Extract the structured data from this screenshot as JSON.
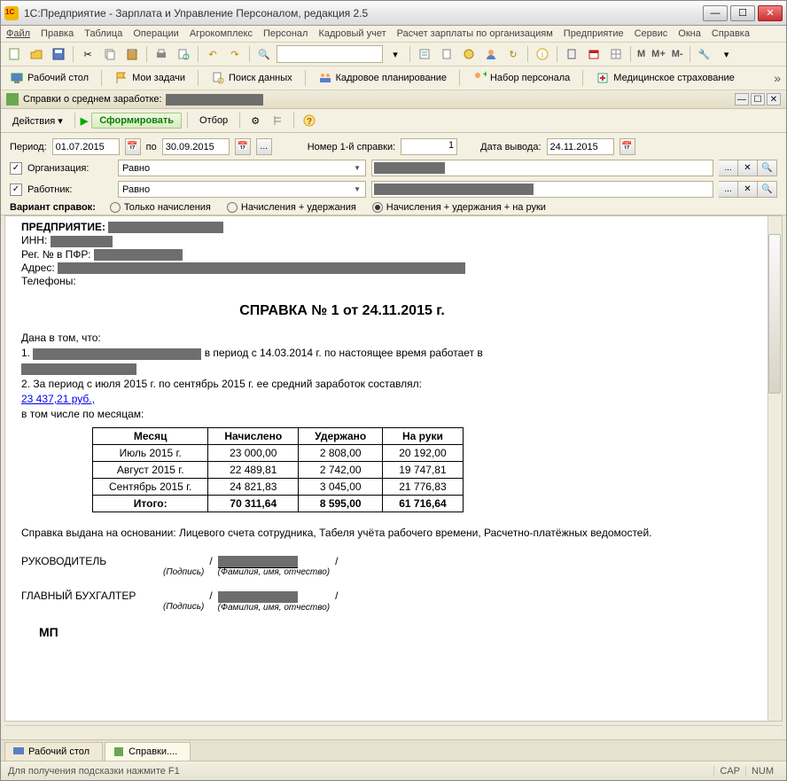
{
  "window": {
    "title": "1С:Предприятие - Зарплата и Управление Персоналом, редакция 2.5"
  },
  "menu": {
    "file": "Файл",
    "edit": "Правка",
    "table": "Таблица",
    "ops": "Операции",
    "agro": "Агрокомплекс",
    "staff": "Персонал",
    "kadr": "Кадровый учет",
    "payroll": "Расчет зарплаты по организациям",
    "enterprise": "Предприятие",
    "service": "Сервис",
    "windows": "Окна",
    "help": "Справка"
  },
  "toolbar_m": {
    "m1": "M",
    "m2": "M+",
    "m3": "M-"
  },
  "navbar": {
    "desktop": "Рабочий стол",
    "tasks": "Мои задачи",
    "search": "Поиск данных",
    "planning": "Кадровое планирование",
    "recruit": "Набор персонала",
    "med": "Медицинское страхование"
  },
  "subwindow": {
    "title": "Справки о среднем заработке:"
  },
  "actionbar": {
    "actions": "Действия",
    "form": "Сформировать",
    "filter": "Отбор"
  },
  "filters": {
    "period_label": "Период:",
    "date_from": "01.07.2015",
    "date_to": "30.09.2015",
    "po": "по",
    "number_label": "Номер 1-й справки:",
    "number_value": "1",
    "outdate_label": "Дата вывода:",
    "outdate_value": "24.11.2015",
    "org_label": "Организация:",
    "org_op": "Равно",
    "worker_label": "Работник:",
    "worker_op": "Равно",
    "variant_label": "Вариант справок:",
    "opt1": "Только начисления",
    "opt2": "Начисления + удержания",
    "opt3": "Начисления + удержания + на руки"
  },
  "doc": {
    "org_label": "ПРЕДПРИЯТИЕ:",
    "inn_label": "ИНН:",
    "pfr_label": "Рег. № в ПФР:",
    "addr_label": "Адрес:",
    "phones_label": "Телефоны:",
    "title": "СПРАВКА № 1 от 24.11.2015 г.",
    "given": "Дана в том, что:",
    "p1_num": "1.",
    "p1_mid": "в период с 14.03.2014 г. по настоящее время работает в",
    "p2": "2. За период с июля 2015  г. по сентябрь 2015  г.  ее средний заработок составлял:",
    "amount": "23 437,21 руб.,",
    "by_month": "в том числе по месяцам:",
    "th_month": "Месяц",
    "th_acc": "Начислено",
    "th_ded": "Удержано",
    "th_net": "На руки",
    "rows": [
      {
        "m": "Июль 2015 г.",
        "a": "23 000,00",
        "d": "2 808,00",
        "n": "20 192,00"
      },
      {
        "m": "Август 2015 г.",
        "a": "22 489,81",
        "d": "2 742,00",
        "n": "19 747,81"
      },
      {
        "m": "Сентябрь 2015 г.",
        "a": "24 821,83",
        "d": "3 045,00",
        "n": "21 776,83"
      }
    ],
    "total_label": "Итого:",
    "total": {
      "a": "70 311,64",
      "d": "8 595,00",
      "n": "61 716,64"
    },
    "basis": "Справка выдана на основании: Лицевого счета сотрудника, Табеля учёта рабочего времени, Расчетно-платёжных ведомостей.",
    "role1": "РУКОВОДИТЕЛЬ",
    "role2": "ГЛАВНЫЙ БУХГАЛТЕР",
    "sig_caption1": "(Подпись)",
    "sig_caption2": "(Фамилия, имя, отчество)",
    "mp": "МП"
  },
  "tabs": {
    "desktop": "Рабочий стол",
    "doc": "Справки...."
  },
  "statusbar": {
    "hint": "Для получения подсказки нажмите F1",
    "cap": "CAP",
    "num": "NUM"
  },
  "chart_data": {
    "type": "table",
    "title": "Средний заработок по месяцам",
    "columns": [
      "Месяц",
      "Начислено",
      "Удержано",
      "На руки"
    ],
    "categories": [
      "Июль 2015 г.",
      "Август 2015 г.",
      "Сентябрь 2015 г.",
      "Итого"
    ],
    "series": [
      {
        "name": "Начислено",
        "values": [
          23000.0,
          22489.81,
          24821.83,
          70311.64
        ]
      },
      {
        "name": "Удержано",
        "values": [
          2808.0,
          2742.0,
          3045.0,
          8595.0
        ]
      },
      {
        "name": "На руки",
        "values": [
          20192.0,
          19747.81,
          21776.83,
          61716.64
        ]
      }
    ]
  }
}
